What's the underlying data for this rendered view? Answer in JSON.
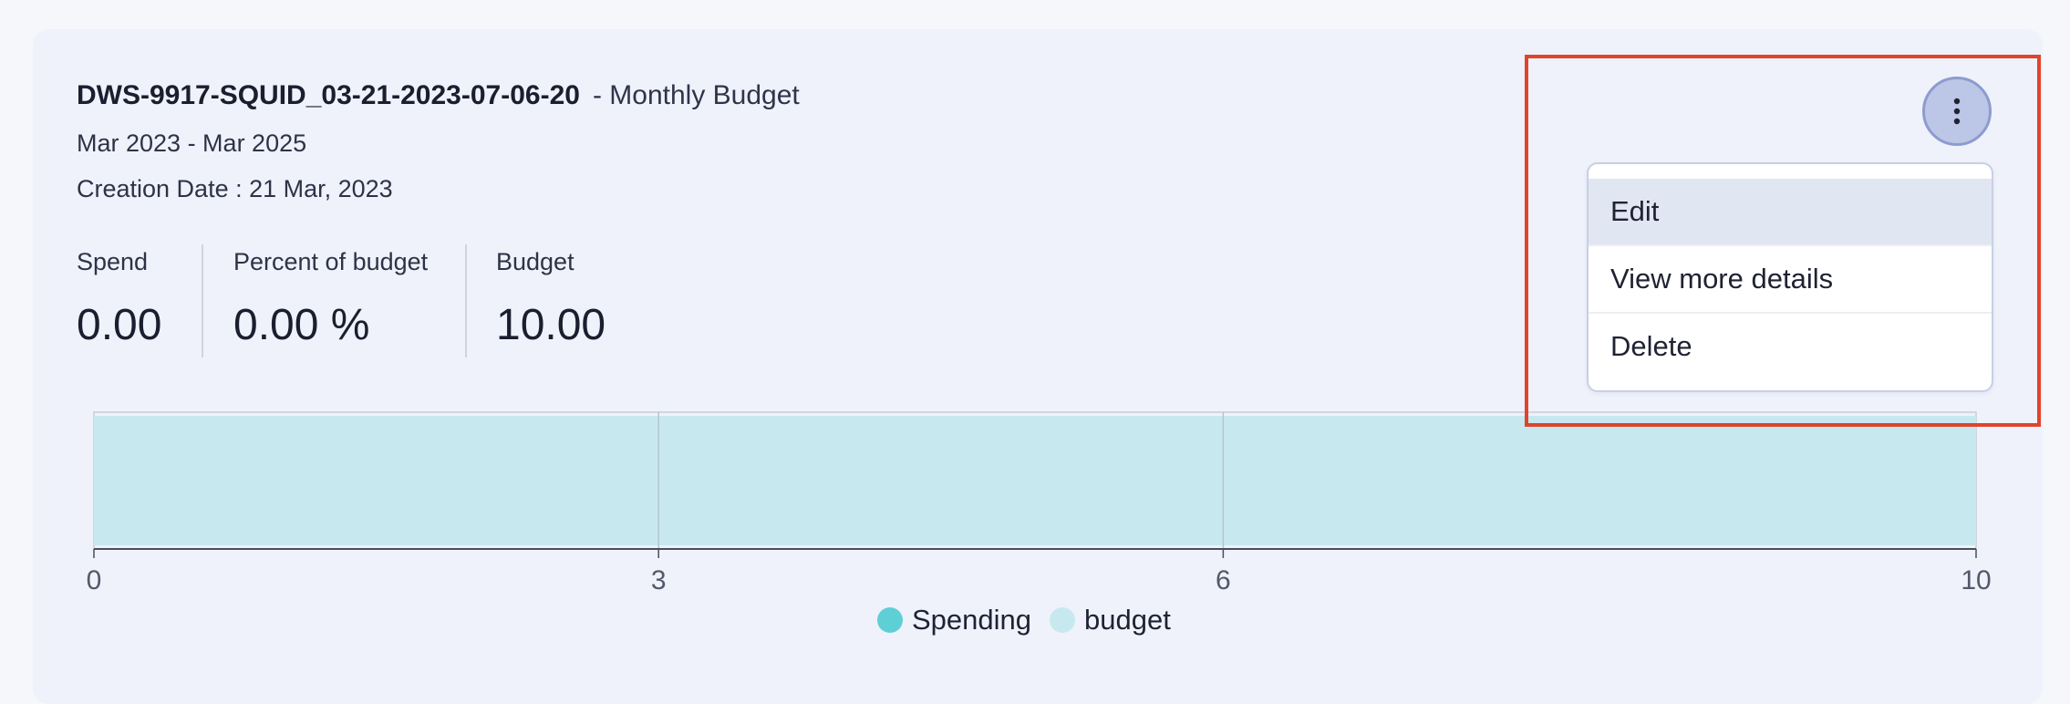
{
  "budget": {
    "name": "DWS-9917-SQUID_03-21-2023-07-06-20",
    "type_suffix": "- Monthly Budget",
    "period": "Mar 2023 - Mar 2025",
    "creation": "Creation Date : 21 Mar, 2023"
  },
  "metrics": [
    {
      "label": "Spend",
      "value": "0.00"
    },
    {
      "label": "Percent of budget",
      "value": "0.00 %"
    },
    {
      "label": "Budget",
      "value": "10.00"
    }
  ],
  "menu": {
    "items": [
      "Edit",
      "View more details",
      "Delete"
    ],
    "active_index": 0
  },
  "colors": {
    "accent_highlight": "#e0442b",
    "spending": "#5fcfd6",
    "budget": "#c8e8f0"
  },
  "chart_data": {
    "type": "bar",
    "orientation": "horizontal",
    "x_ticks": [
      "0",
      "3",
      "6",
      "10"
    ],
    "xlim": [
      0,
      10
    ],
    "series": [
      {
        "name": "Spending",
        "values": [
          0
        ]
      },
      {
        "name": "budget",
        "values": [
          10
        ]
      }
    ],
    "legend": [
      "Spending",
      "budget"
    ],
    "legend_position": "bottom-center",
    "grid": true
  }
}
